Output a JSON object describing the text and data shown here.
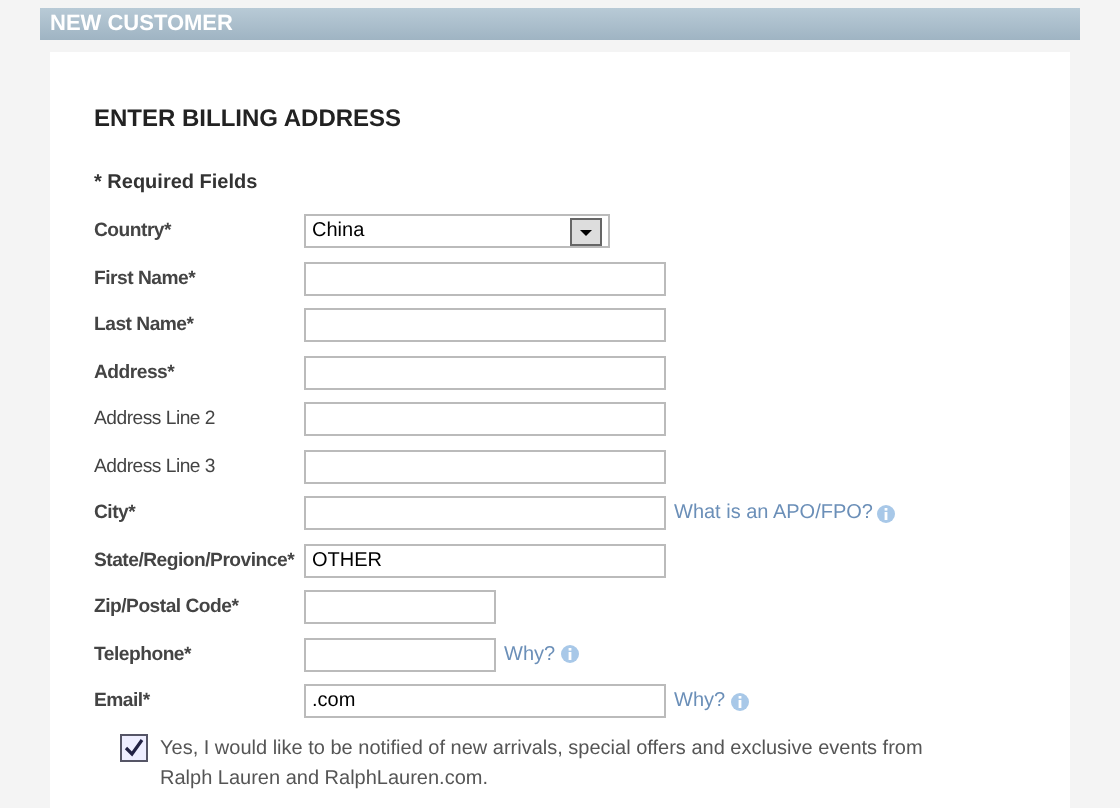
{
  "header": {
    "title": "NEW CUSTOMER"
  },
  "form": {
    "title": "ENTER BILLING ADDRESS",
    "note": "* Required Fields",
    "fields": [
      {
        "kind": "select",
        "label": "Country*",
        "required": true,
        "value": "China"
      },
      {
        "kind": "text",
        "label": "First Name*",
        "required": true
      },
      {
        "kind": "text",
        "label": "Last Name*",
        "required": true
      },
      {
        "kind": "text",
        "label": "Address*",
        "required": true
      },
      {
        "kind": "text",
        "label": "Address Line 2",
        "required": false
      },
      {
        "kind": "text",
        "label": "Address Line 3",
        "required": false
      },
      {
        "kind": "text",
        "label": "City*",
        "required": true,
        "help": "What is an APO/FPO?"
      },
      {
        "kind": "text",
        "label": "State/Region/Province*",
        "required": true,
        "value": "OTHER"
      },
      {
        "kind": "short",
        "label": "Zip/Postal Code*",
        "required": true
      },
      {
        "kind": "short",
        "label": "Telephone*",
        "required": true,
        "help": "Why?"
      },
      {
        "kind": "text",
        "label": "Email*",
        "required": true,
        "value": ".com",
        "help": "Why?"
      }
    ],
    "optin": {
      "checked": true,
      "text": "Yes, I would like to be notified of new arrivals, special offers and exclusive events from Ralph Lauren and RalphLauren.com."
    }
  }
}
